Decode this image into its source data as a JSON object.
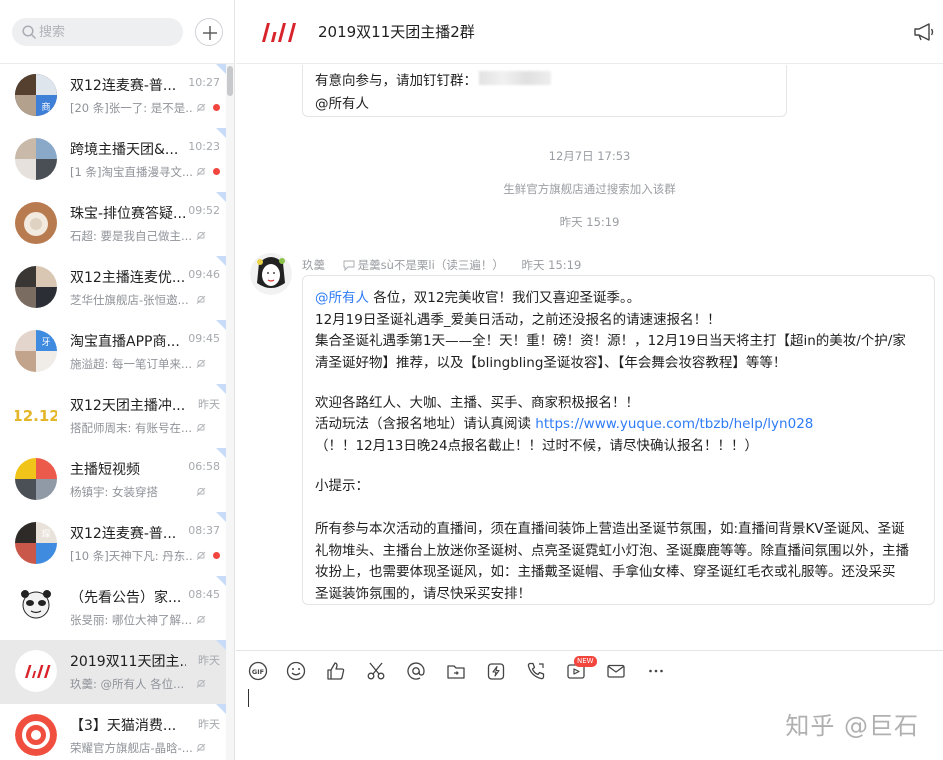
{
  "search": {
    "placeholder": "搜索"
  },
  "conversations": [
    {
      "title": "双12连麦赛-普...",
      "time": "10:27",
      "preview": "[20 条]张一了: 是不是...",
      "unread": true,
      "avatar": "a1"
    },
    {
      "title": "跨境主播天团&...",
      "time": "10:23",
      "preview": "[1 条]淘宝直播漫寻文...",
      "unread": true,
      "avatar": "a2"
    },
    {
      "title": "珠宝-排位赛答疑...",
      "time": "09:52",
      "preview": "石超: 要是我自己做主...",
      "unread": false,
      "avatar": "a3"
    },
    {
      "title": "双12主播连麦优...",
      "time": "09:46",
      "preview": "芝华仕旗舰店-张恒邀...",
      "unread": false,
      "avatar": "a4"
    },
    {
      "title": "淘宝直播APP商...",
      "time": "09:45",
      "preview": "施溢超: 每一笔订单来...",
      "unread": false,
      "avatar": "a5"
    },
    {
      "title": "双12天团主播冲...",
      "time": "昨天",
      "preview": "搭配师周末: 有账号在...",
      "unread": false,
      "avatar": "a6"
    },
    {
      "title": "主播短视频",
      "time": "06:58",
      "preview": "杨镇宇: 女装穿搭",
      "unread": false,
      "avatar": "a7"
    },
    {
      "title": "双12连麦赛-普...",
      "time": "08:37",
      "preview": "[10 条]天神下凡: 丹东...",
      "unread": true,
      "avatar": "a8"
    },
    {
      "title": "（先看公告）家...",
      "time": "08:45",
      "preview": "张旻丽: 哪位大神了解...",
      "unread": false,
      "avatar": "a9"
    },
    {
      "title": "2019双11天团主...",
      "time": "昨天",
      "preview": "玖羹: @所有人 各位...",
      "unread": false,
      "avatar": "a10",
      "active": true
    },
    {
      "title": "【3】天猫消费...",
      "time": "昨天",
      "preview": "荣耀官方旗舰店-晶晗-...",
      "unread": false,
      "avatar": "a11"
    }
  ],
  "header": {
    "title": "2019双11天团主播2群"
  },
  "prev_message": {
    "line1": "有意向参与，请加钉钉群：",
    "line2": "@所有人"
  },
  "system": {
    "date1": "12月7日 17:53",
    "joined": "生鲜官方旗舰店通过搜索加入该群",
    "date2": "昨天 15:19"
  },
  "sender": {
    "name": "玖羹",
    "quote": "是羹sù不是栗li（读三遍！）",
    "time": "昨天 15:19"
  },
  "message": {
    "line1_at": "@所有人",
    "line1": " 各位，双12完美收官！我们又喜迎圣诞季。。",
    "line2": "12月19日圣诞礼遇季_爱美日活动，之前还没报名的请速速报名！！",
    "line3": "集合圣诞礼遇季第1天——全！天！重！磅！资！源！，12月19日当天将主打【超in的美妆/个护/家",
    "line4": "清圣诞好物】推荐，以及【blingbling圣诞妆容】、【年会舞会妆容教程】等等！",
    "line5": "欢迎各路红人、大咖、主播、买手、商家积极报名！！",
    "line6": "活动玩法（含报名地址）请认真阅读 ",
    "line6_link": "https://www.yuque.com/tbzb/help/lyn028",
    "line7": "（！！12月13日晚24点报名截止！！过时不候，请尽快确认报名！！！）",
    "line8": "小提示：",
    "line9": "所有参与本次活动的直播间，须在直播间装饰上营造出圣诞节氛围，如:直播间背景KV圣诞风、圣诞",
    "line10": "礼物堆头、主播台上放迷你圣诞树、点亮圣诞霓虹小灯泡、圣诞麋鹿等等。除直播间氛围以外，主播",
    "line11": "妆扮上，也需要体现圣诞风，如：主播戴圣诞帽、手拿仙女棒、穿圣诞红毛衣或礼服等。还没采买",
    "line12": "圣诞装饰氛围的，请尽快采买安排！"
  },
  "composer": {
    "new_badge": "NEW",
    "gif_label": "GIF"
  },
  "watermark": "知乎 @巨石",
  "colors": {
    "accent": "#2f7cf6",
    "unread": "#f2453d",
    "active_row": "#e9e9ea"
  }
}
